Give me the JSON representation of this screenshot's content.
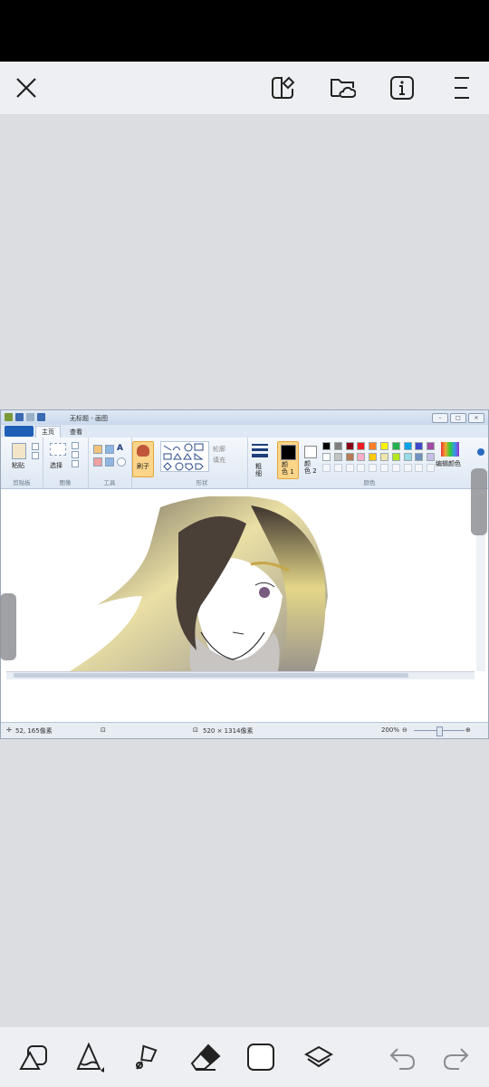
{
  "top_bar": {
    "buttons": [
      "close-icon",
      "selection-shape-icon",
      "cloud-folder-icon",
      "info-icon",
      "menu-icon"
    ]
  },
  "paint": {
    "title": "无标题 - 画图",
    "tabs": [
      "主页",
      "查看"
    ],
    "groups": {
      "clipboard": {
        "label": "剪贴板",
        "paste": "粘贴"
      },
      "image": {
        "label": "图像",
        "select": "选择"
      },
      "tools": {
        "label": "工具"
      },
      "brush": {
        "label": "刷子"
      },
      "shapes": {
        "label": "形状",
        "outline": "轮廓",
        "fill": "填充"
      },
      "size": {
        "label": "粗\n细"
      },
      "colors": {
        "label": "颜色",
        "color1": "颜\n色 1",
        "color2": "颜\n色 2",
        "edit": "编辑颜色"
      }
    },
    "palette_row1": [
      "#000000",
      "#7f7f7f",
      "#880015",
      "#ed1c24",
      "#ff7f27",
      "#fff200",
      "#22b14c",
      "#00a2e8",
      "#3f48cc",
      "#a349a4"
    ],
    "palette_row2": [
      "#ffffff",
      "#c3c3c3",
      "#b97a57",
      "#ffaec9",
      "#ffc90e",
      "#efe4b0",
      "#b5e61d",
      "#99d9ea",
      "#7092be",
      "#c8bfe7"
    ],
    "status": {
      "cursor": "52, 165像素",
      "size": "520 × 1314像素",
      "zoom": "200%"
    }
  },
  "bottom_bar": {
    "tools": [
      "shapes-icon",
      "pencil-icon",
      "lasso-icon",
      "eraser-icon",
      "color-square-icon",
      "layers-icon"
    ],
    "undo": "undo-icon",
    "redo": "redo-icon"
  }
}
